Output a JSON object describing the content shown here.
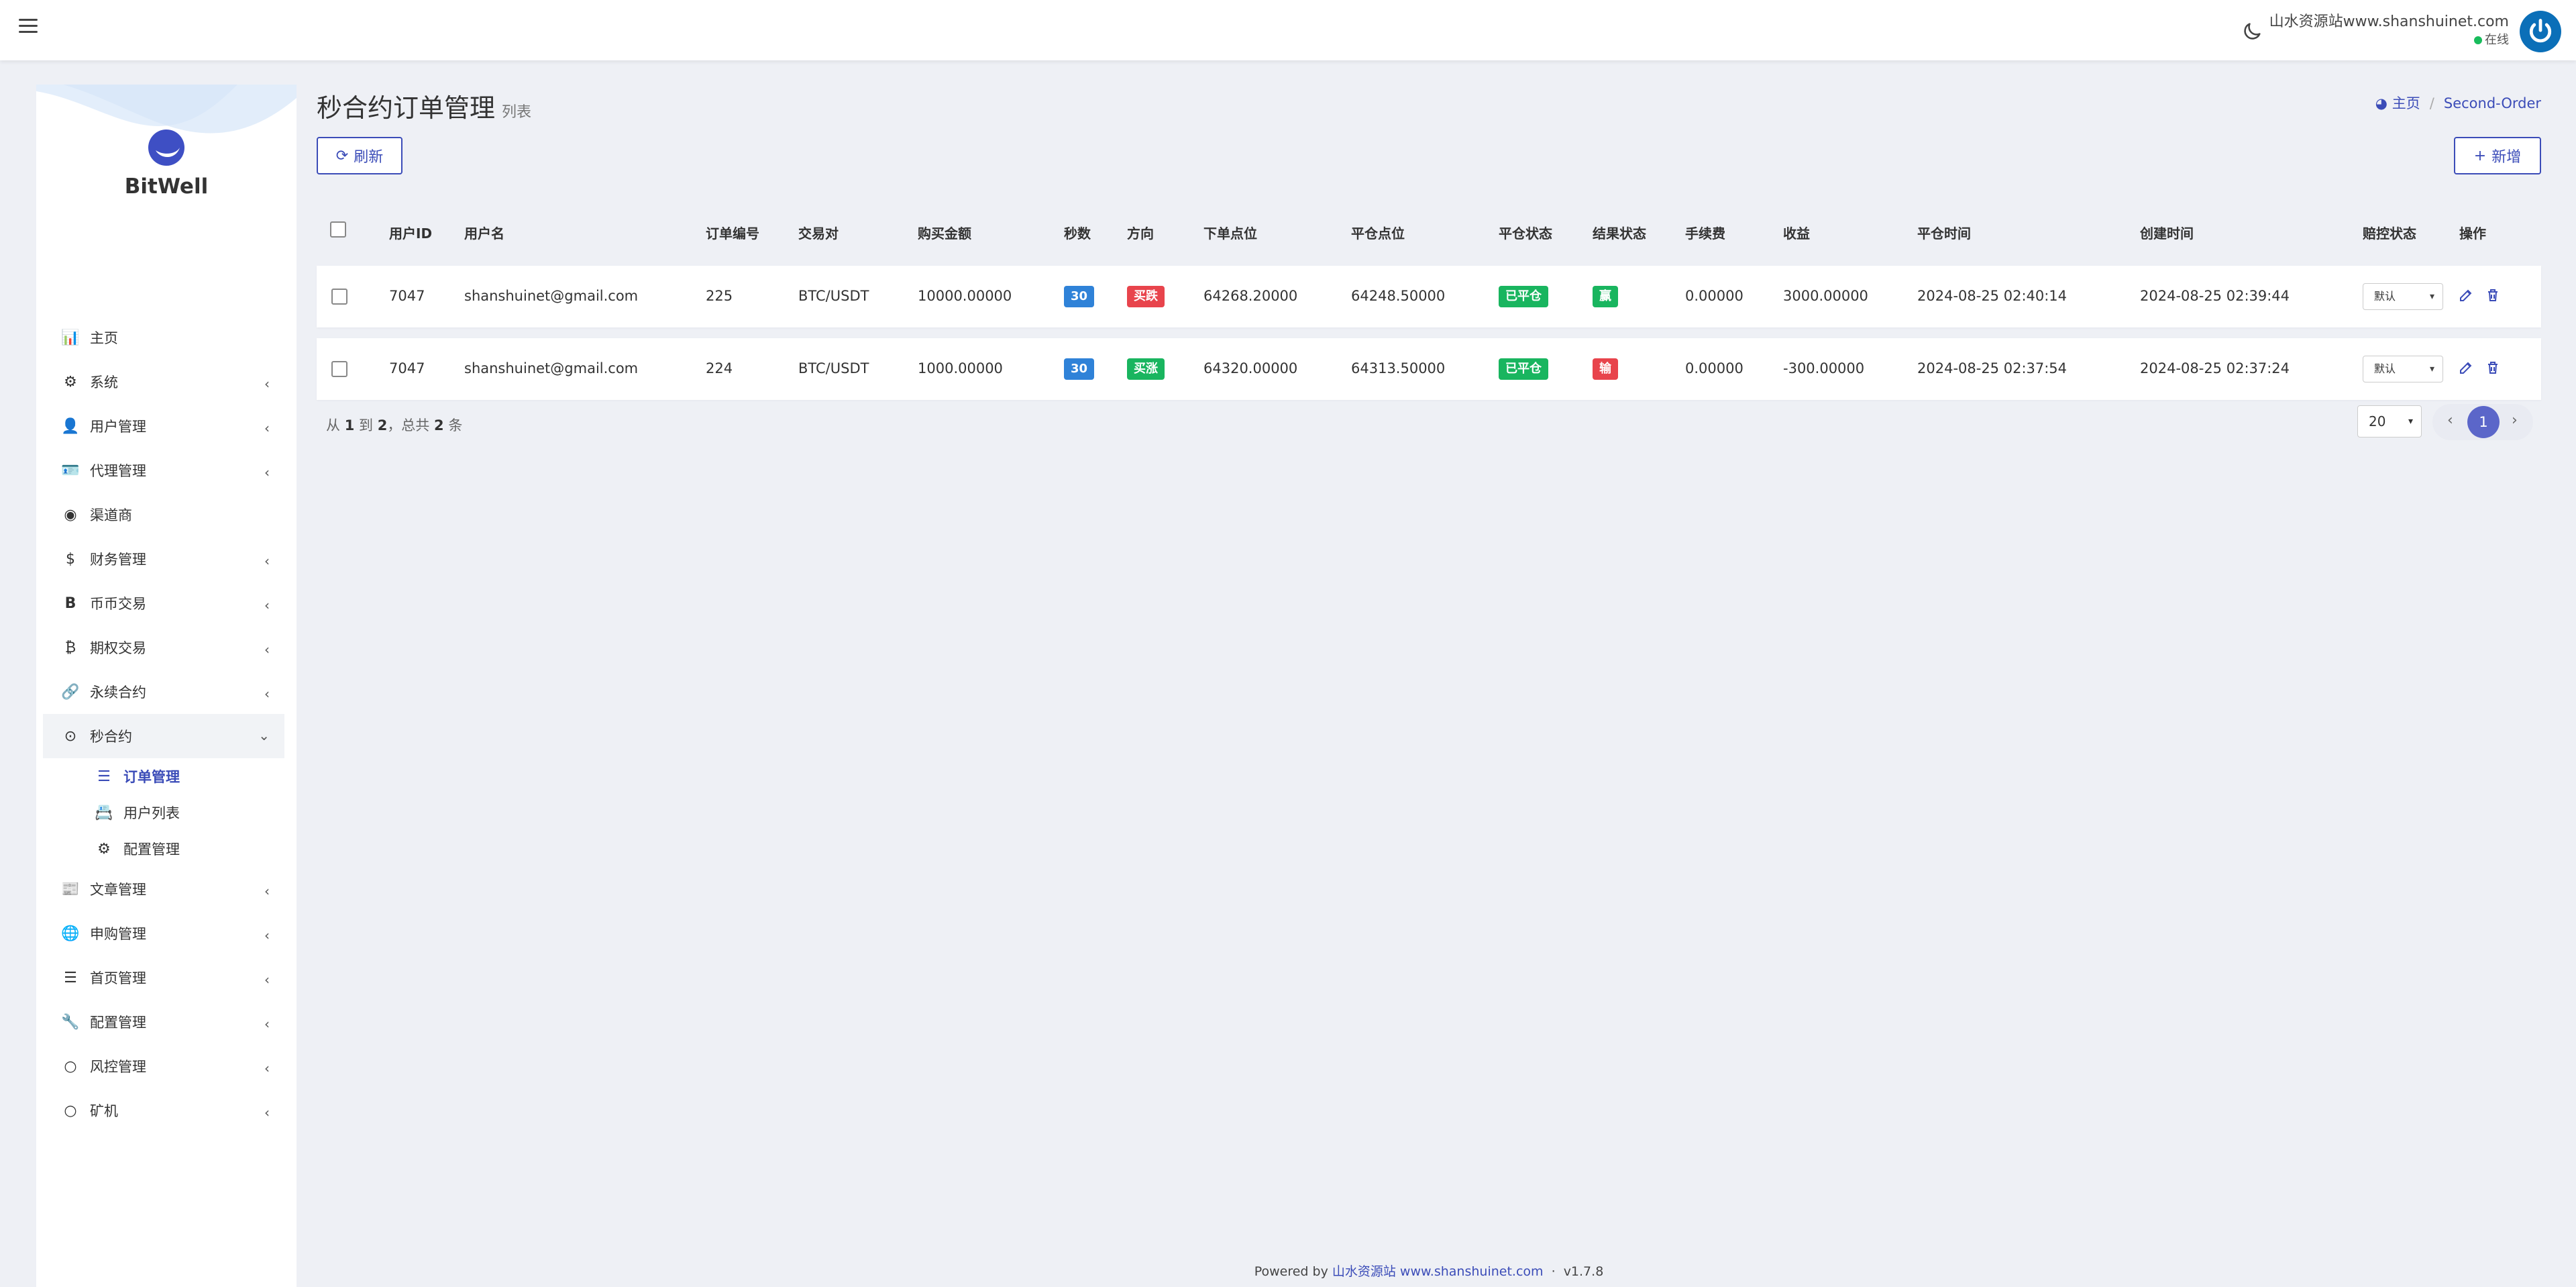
{
  "header": {
    "user_name": "山水资源站www.shanshuinet.com",
    "status": "在线"
  },
  "sidebar": {
    "brand": "BitWell",
    "items": [
      {
        "label": "主页",
        "icon": "dashboard-icon"
      },
      {
        "label": "系统",
        "icon": "gear-icon"
      },
      {
        "label": "用户管理",
        "icon": "user-icon"
      },
      {
        "label": "代理管理",
        "icon": "id-card-icon"
      },
      {
        "label": "渠道商",
        "icon": "user-circle-icon"
      },
      {
        "label": "财务管理",
        "icon": "dollar-icon"
      },
      {
        "label": "币币交易",
        "icon": "bitcoin-b-icon"
      },
      {
        "label": "期权交易",
        "icon": "bitcoin-icon"
      },
      {
        "label": "永续合约",
        "icon": "link-icon"
      },
      {
        "label": "秒合约",
        "icon": "dot-circle-icon"
      },
      {
        "label": "文章管理",
        "icon": "newspaper-icon"
      },
      {
        "label": "申购管理",
        "icon": "globe-icon"
      },
      {
        "label": "首页管理",
        "icon": "bars-icon"
      },
      {
        "label": "配置管理",
        "icon": "wrench-icon"
      },
      {
        "label": "风控管理",
        "icon": "circle-icon"
      },
      {
        "label": "矿机",
        "icon": "circle-icon"
      }
    ],
    "submenu": [
      {
        "label": "订单管理",
        "icon": "list-icon"
      },
      {
        "label": "用户列表",
        "icon": "address-book-icon"
      },
      {
        "label": "配置管理",
        "icon": "cog-icon"
      }
    ]
  },
  "page": {
    "title": "秒合约订单管理",
    "subtitle": "列表",
    "breadcrumb_home": "主页",
    "breadcrumb_current": "Second-Order",
    "refresh_label": "刷新",
    "add_label": "新增"
  },
  "table": {
    "columns": [
      "用户ID",
      "用户名",
      "订单编号",
      "交易对",
      "购买金额",
      "秒数",
      "方向",
      "下单点位",
      "平仓点位",
      "平仓状态",
      "结果状态",
      "手续费",
      "收益",
      "平仓时间",
      "创建时间",
      "赔控状态",
      "操作"
    ],
    "rows": [
      {
        "user_id": "7047",
        "username": "shanshuinet@gmail.com",
        "order_no": "225",
        "pair": "BTC/USDT",
        "amount": "10000.00000",
        "seconds": "30",
        "direction": "买跌",
        "open_price": "64268.20000",
        "close_price": "64248.50000",
        "close_status": "已平仓",
        "result": "赢",
        "fee": "0.00000",
        "profit": "3000.00000",
        "close_time": "2024-08-25 02:40:14",
        "create_time": "2024-08-25 02:39:44",
        "control": "默认"
      },
      {
        "user_id": "7047",
        "username": "shanshuinet@gmail.com",
        "order_no": "224",
        "pair": "BTC/USDT",
        "amount": "1000.00000",
        "seconds": "30",
        "direction": "买涨",
        "open_price": "64320.00000",
        "close_price": "64313.50000",
        "close_status": "已平仓",
        "result": "输",
        "fee": "0.00000",
        "profit": "-300.00000",
        "close_time": "2024-08-25 02:37:54",
        "create_time": "2024-08-25 02:37:24",
        "control": "默认"
      }
    ]
  },
  "pagination": {
    "prefix": "从",
    "from": "1",
    "to_word": "到",
    "to": "2",
    "total_word": "，总共",
    "total": "2",
    "suffix": "条",
    "page_size": "20",
    "current_page": "1",
    "prev_glyph": "‹",
    "next_glyph": "›"
  },
  "footer": {
    "powered": "Powered by",
    "link": "山水资源站 www.shanshuinet.com",
    "sep": "·",
    "version": "v1.7.8"
  },
  "colors": {
    "accent": "#3b4cb8",
    "buy_down": "#e8444c",
    "buy_up": "#19b55f",
    "seconds_badge": "#2f82d8"
  }
}
